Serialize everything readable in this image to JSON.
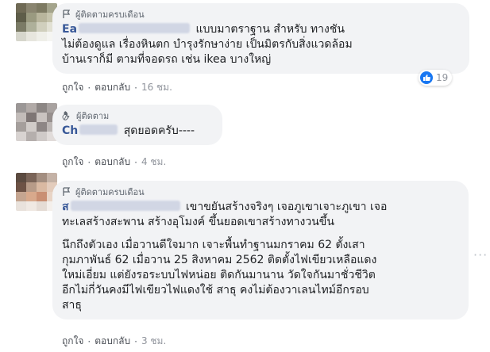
{
  "comments": [
    {
      "badge": "ผู้ติดตามครบเดือน",
      "author_visible": "Ea",
      "lines": [
        "แบบมาตราฐาน สำหรับ ทางชัน",
        "ไม่ต้องดูแล เรื่องหินตก บำรุงรักษาง่าย เป็นมิตรกับสิ่งแวดล้อม",
        "บ้านเราก็มี ตามที่จอดรถ เช่น ikea บางใหญ่"
      ],
      "actions": {
        "like": "ถูกใจ",
        "reply": "ตอบกลับ",
        "time": "16 ชม."
      },
      "reaction_count": "19"
    },
    {
      "badge": "ผู้ติดตาม",
      "author_visible": "Ch",
      "lines": [
        "สุดยอดครับ----"
      ],
      "actions": {
        "like": "ถูกใจ",
        "reply": "ตอบกลับ",
        "time": "4 ชม."
      }
    },
    {
      "badge": "ผู้ติดตามครบเดือน",
      "author_visible": "ส",
      "lines": [
        "เขาขยันสร้างจริงๆ เจอภูเขาเจาะภูเขา เจอ",
        "ทะเลสร้างสะพาน สร้างอุโมงค์ ขึ้นยอดเขาสร้างทางวนขึ้น"
      ],
      "lines2": [
        "นึกถึงตัวเอง เมื่อวานดีใจมาก เจาะพื้นทำฐานมกราคม 62 ตั้งเสา",
        "กุมภาพันธ์ 62 เมื่อวาน 25 สิงหาคม 2562 ติดตั้งไฟเขียวเหลือแดง",
        "ใหม่เอี่ยม แต่ยังรอระบบไฟหน่อย ติดกันมานาน วัดใจกันมาชั่วชีวิต",
        "อีกไม่กี่วันคงมีไฟเขียวไฟแดงใช้ สาธุ คงไม่ต้องวาเลนไทม์อีกรอบ",
        "สาธุ"
      ],
      "actions": {
        "like": "ถูกใจ",
        "reply": "ตอบกลับ",
        "time": "3 ชม."
      },
      "more": "···"
    }
  ],
  "colors": {
    "author": "#385898",
    "bubble": "#f2f3f5",
    "like_blue": "#1877f2"
  }
}
